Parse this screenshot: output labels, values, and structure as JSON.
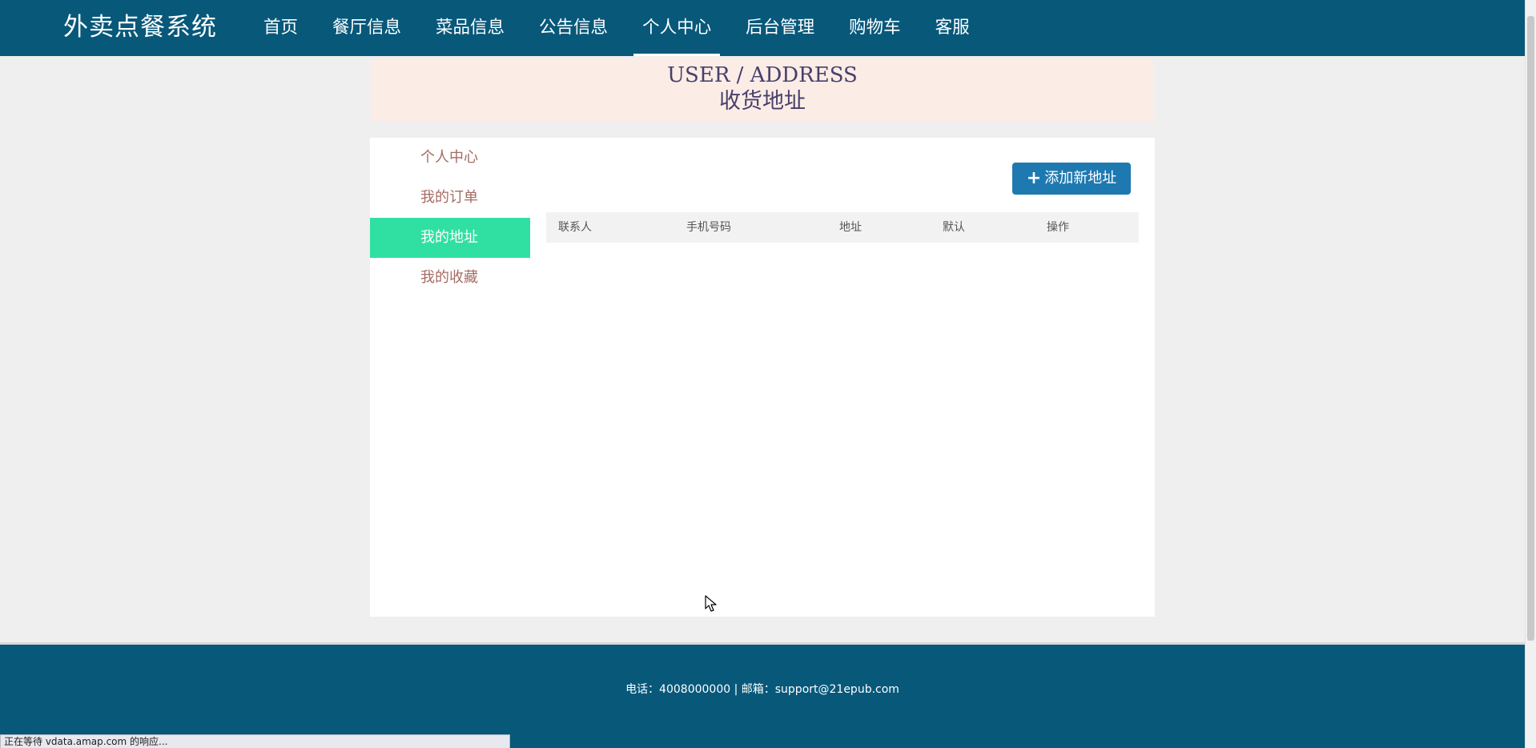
{
  "header": {
    "brand": "外卖点餐系统",
    "menu": [
      {
        "label": "首页",
        "active": false
      },
      {
        "label": "餐厅信息",
        "active": false
      },
      {
        "label": "菜品信息",
        "active": false
      },
      {
        "label": "公告信息",
        "active": false
      },
      {
        "label": "个人中心",
        "active": true
      },
      {
        "label": "后台管理",
        "active": false
      },
      {
        "label": "购物车",
        "active": false
      },
      {
        "label": "客服",
        "active": false
      }
    ]
  },
  "banner": {
    "title_en": "USER / ADDRESS",
    "title_cn": "收货地址"
  },
  "sidebar": {
    "items": [
      {
        "label": "个人中心",
        "active": false
      },
      {
        "label": "我的订单",
        "active": false
      },
      {
        "label": "我的地址",
        "active": true
      },
      {
        "label": "我的收藏",
        "active": false
      }
    ]
  },
  "address": {
    "add_button_label": "添加新地址",
    "columns": [
      "联系人",
      "手机号码",
      "地址",
      "默认",
      "操作"
    ]
  },
  "footer": {
    "text": "电话：4008000000 | 邮箱：support@21epub.com"
  },
  "status_bar": {
    "text": "正在等待 vdata.amap.com 的响应..."
  },
  "colors": {
    "nav_bg": "#08587a",
    "accent_active": "#30e0a3",
    "button_bg": "#1e79b1",
    "banner_bg": "#fcece6",
    "sidebar_text": "#a46c63"
  }
}
